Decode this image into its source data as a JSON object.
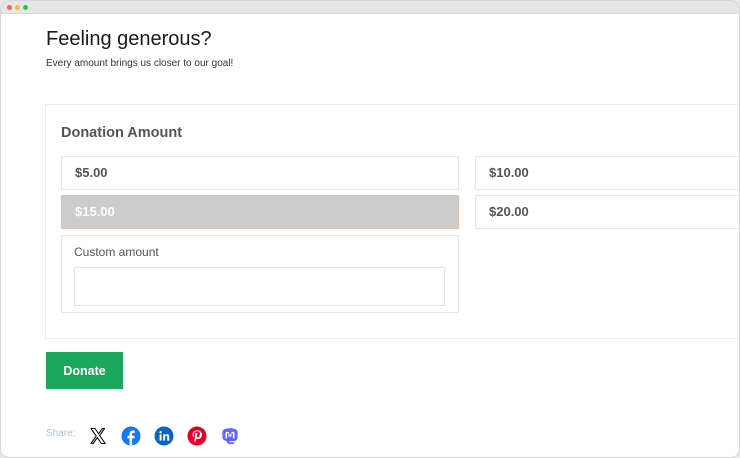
{
  "window": {
    "controls": [
      "close",
      "minimize",
      "zoom"
    ]
  },
  "page": {
    "title": "Feeling generous?",
    "subtitle": "Every amount brings us closer to our goal!"
  },
  "donation": {
    "heading": "Donation Amount",
    "options": [
      {
        "label": "$5.00",
        "selected": false
      },
      {
        "label": "$10.00",
        "selected": false
      },
      {
        "label": "$15.00",
        "selected": true
      },
      {
        "label": "$20.00",
        "selected": false
      }
    ],
    "custom_label": "Custom amount",
    "custom_value": ""
  },
  "donate_button": "Donate",
  "share": {
    "label": "Share:",
    "icons": [
      "x-icon",
      "facebook-icon",
      "linkedin-icon",
      "pinterest-icon",
      "mastodon-icon"
    ]
  },
  "colors": {
    "donate_button": "#1ca85c",
    "selected_option": "#cccccc",
    "facebook": "#1877f2",
    "linkedin": "#0a66c2",
    "pinterest": "#e60023",
    "mastodon": "#6364ff"
  }
}
